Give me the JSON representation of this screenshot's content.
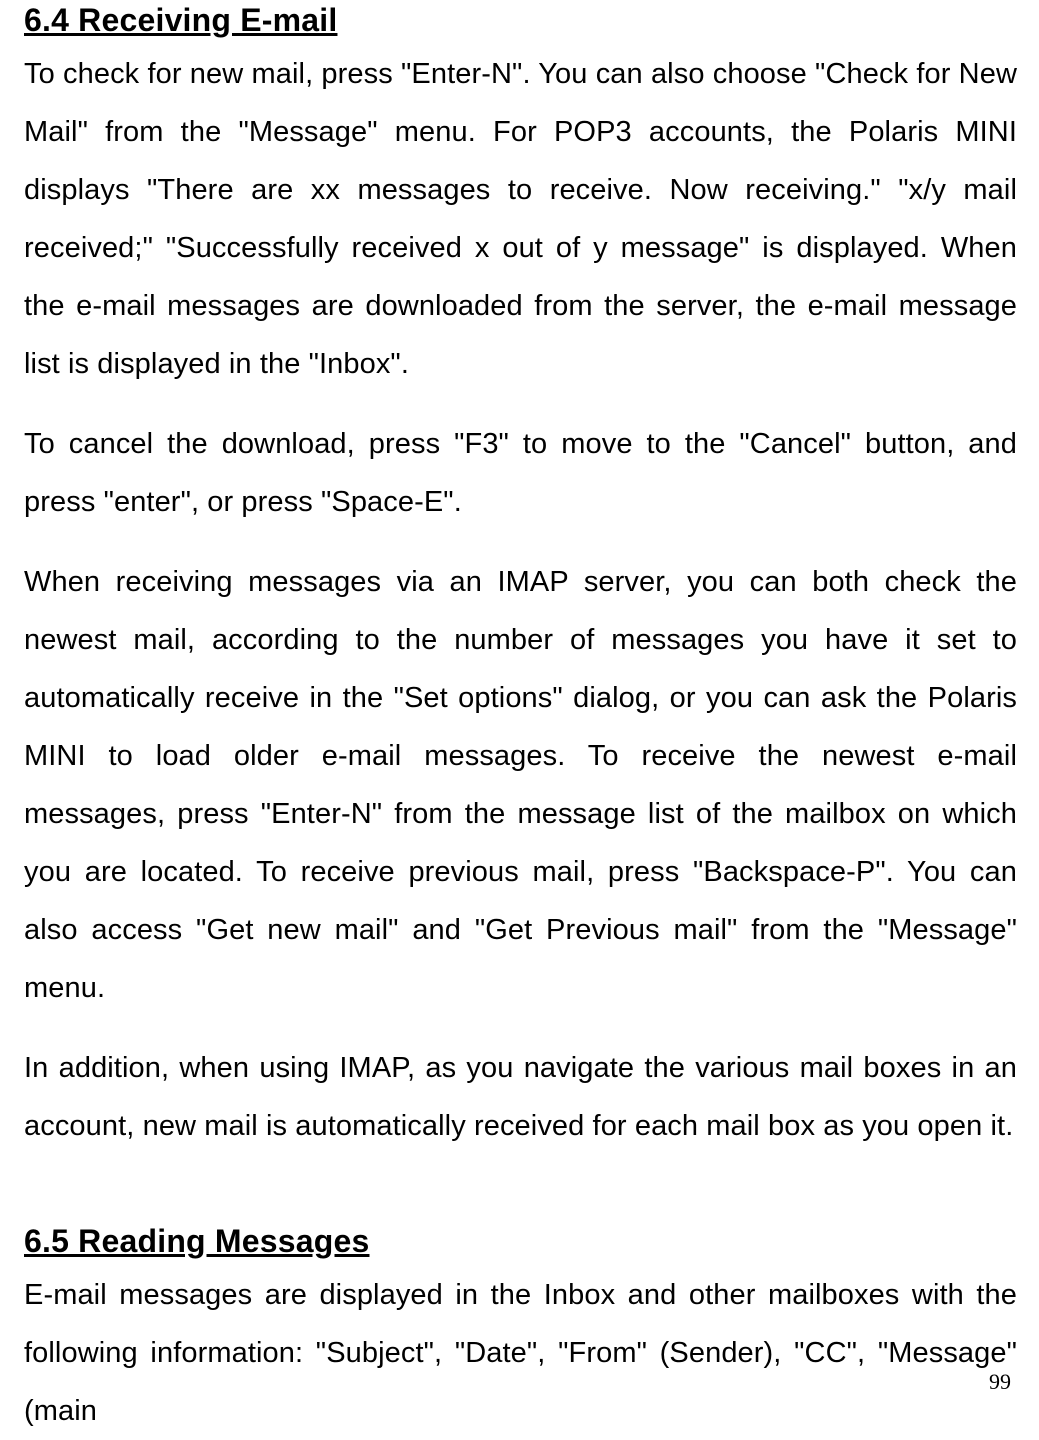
{
  "sections": {
    "receiving": {
      "heading": "6.4 Receiving E-mail",
      "p1": "To check for new mail, press \"Enter-N\". You can also choose \"Check for New Mail\" from the \"Message\" menu. For POP3 accounts, the Polaris MINI displays \"There are xx messages to receive. Now receiving.\" \"x/y mail received;\" \"Successfully received x out of y message\" is displayed. When the e-mail messages are downloaded from the server, the e-mail message list is displayed in the \"Inbox\".",
      "p2": "To cancel the download, press \"F3\" to move to the \"Cancel\" button, and press \"enter\", or press \"Space-E\".",
      "p3": "When receiving messages via an IMAP server, you can both check the newest mail, according to the number of messages you have it set to automatically receive in the \"Set options\" dialog, or you can ask the Polaris MINI to load older e-mail messages. To receive the newest e-mail messages, press \"Enter-N\" from the message list of the mailbox on which you are located. To receive previous mail, press \"Backspace-P\". You can also access \"Get new mail\" and \"Get Previous mail\" from the \"Message\" menu.",
      "p4": "In addition, when using IMAP, as you navigate the various mail boxes in an account, new mail is automatically received for each mail box as you open it."
    },
    "reading": {
      "heading": "6.5 Reading Messages",
      "p1": "E-mail messages are displayed in the Inbox and other mailboxes with the following information: \"Subject\", \"Date\", \"From\" (Sender), \"CC\", \"Message\" (main"
    }
  },
  "page_number": "99"
}
